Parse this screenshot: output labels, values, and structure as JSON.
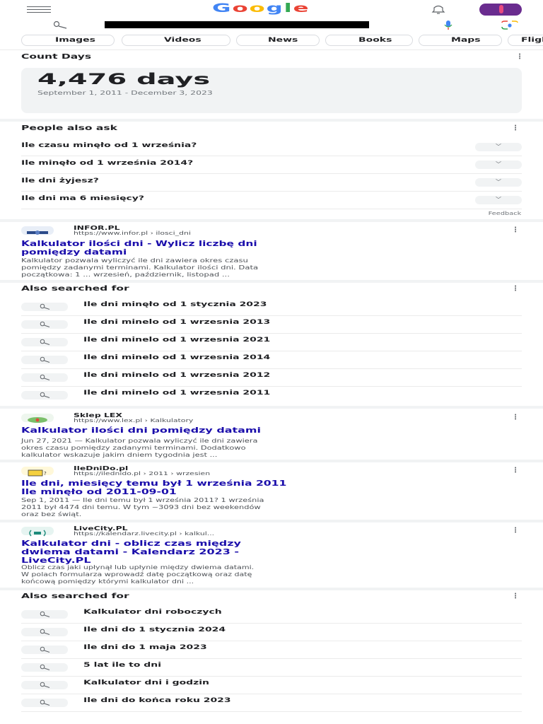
{
  "header": {
    "logo_text": "Google",
    "logo_colors": [
      "#4285f4",
      "#ea4335",
      "#fbbc05",
      "#4285f4",
      "#34a853",
      "#ea4335"
    ]
  },
  "search": {
    "query": "",
    "query_redacted": true
  },
  "chips": [
    "Images",
    "Videos",
    "News",
    "Books",
    "Maps",
    "Flights"
  ],
  "count_days": {
    "title": "Count Days",
    "result": "4,476 days",
    "range": "September 1, 2011 - December 3, 2023"
  },
  "people_also_ask": {
    "title": "People also ask",
    "questions": [
      "Ile czasu minęło od 1 września?",
      "Ile minęło od 1 września 2014?",
      "Ile dni żyjesz?",
      "Ile dni ma 6 miesięcy?"
    ],
    "feedback": "Feedback"
  },
  "results": [
    {
      "site": "INFOR.PL",
      "url": "https://www.infor.pl › ilosci_dni",
      "title_lines": [
        "Kalkulator ilości dni - Wylicz liczbę dni",
        "pomiędzy datami"
      ],
      "snippet_lines": [
        "Kalkulator pozwala wyliczyć ile dni zawiera okres czasu",
        "pomiędzy zadanymi terminami. Kalkulator ilości dni. Data",
        "początkowa: 1 ... wrzesień, październik, listopad ..."
      ]
    },
    {
      "site": "Sklep LEX",
      "url": "https://www.lex.pl › Kalkulatory",
      "title_lines": [
        "Kalkulator ilości dni pomiędzy datami"
      ],
      "snippet_lines": [
        "Jun 27, 2021 — Kalkulator pozwala wyliczyć ile dni zawiera",
        "okres czasu pomiędzy zadanymi terminami. Dodatkowo",
        "kalkulator wskazuje jakim dniem tygodnia jest ..."
      ]
    },
    {
      "site": "IleDniDo.pl",
      "url": "https://iledni​do.pl › 2011 › wrzesien",
      "title_lines": [
        "Ile dni, miesięcy temu był 1 września 2011",
        "Ile minęło od 2011-09-01"
      ],
      "snippet_lines": [
        "Sep 1, 2011 — Ile dni temu był 1 września 2011? 1 września",
        "2011 był 4474 dni temu. W tym ~3093 dni bez weekendów",
        "oraz bez świąt."
      ]
    },
    {
      "site": "LiveCity.PL",
      "url": "https://kalendarz.livecity.pl › kalkul...",
      "title_lines": [
        "Kalkulator dni - oblicz czas między",
        "dwiema datami - Kalendarz 2023 -",
        "LiveCity.PL"
      ],
      "snippet_lines": [
        "Oblicz czas jaki upłynął lub upłynie między dwiema datami.",
        "W polach formularza wprowadź datę początkową oraz datę",
        "końcową pomiędzy którymi kalkulator dni ..."
      ]
    }
  ],
  "also_searched_1": {
    "title": "Also searched for",
    "items": [
      "Ile dni minęło od 1 stycznia 2023",
      "Ile dni minelo od 1 wrzesnia 2013",
      "Ile dni minelo od 1 wrzesnia 2021",
      "Ile dni minelo od 1 wrzesnia 2014",
      "Ile dni minelo od 1 wrzesnia 2012",
      "Ile dni minelo od 1 wrzesnia 2011"
    ]
  },
  "also_searched_2": {
    "title": "Also searched for",
    "items": [
      "Kalkulator dni roboczych",
      "Ile dni do 1 stycznia 2024",
      "Ile dni do 1 maja 2023",
      "5 lat ile to dni",
      "Kalkulator dni i godzin",
      "Ile dni do końca roku 2023"
    ]
  }
}
